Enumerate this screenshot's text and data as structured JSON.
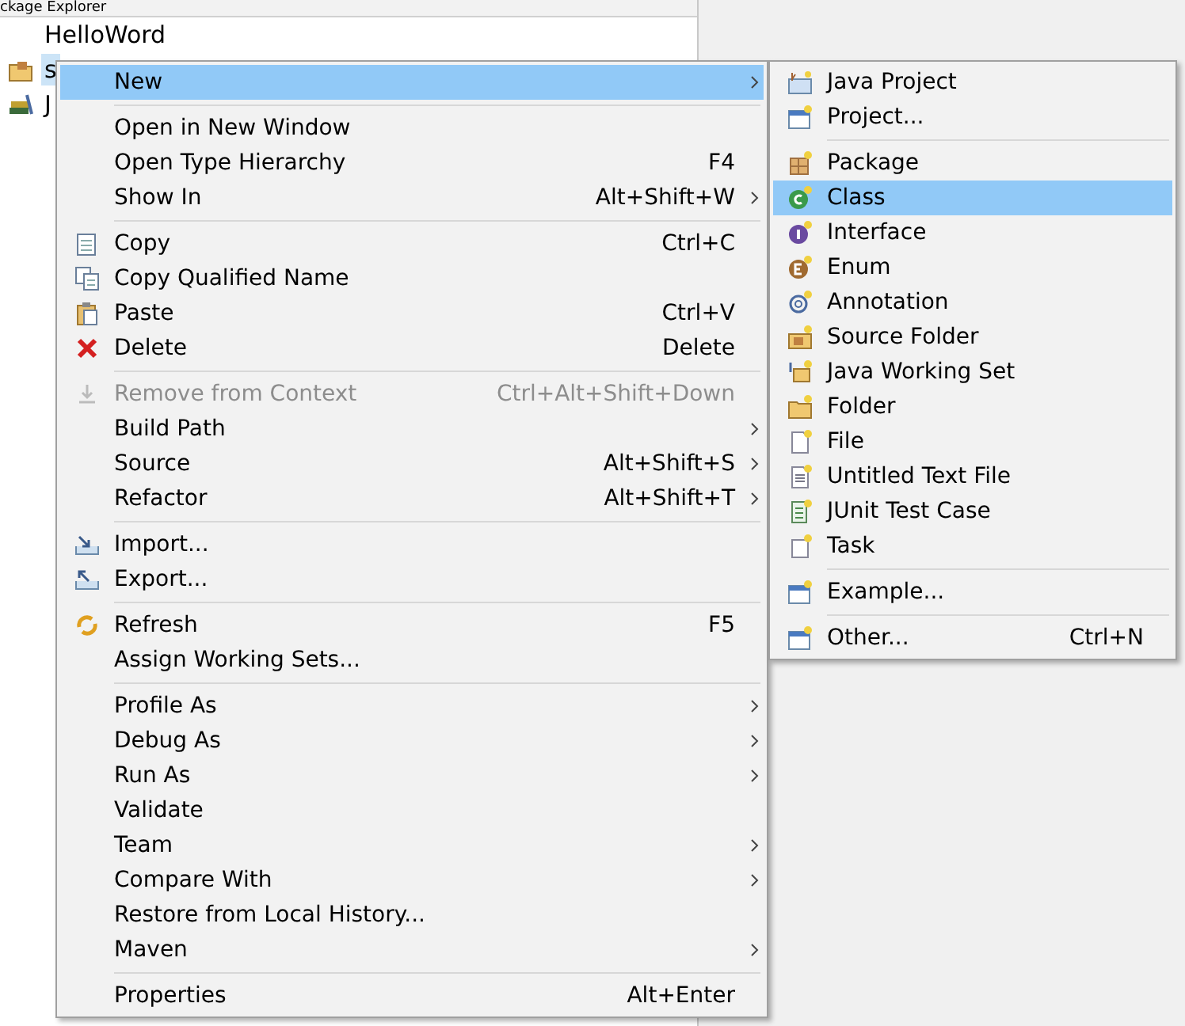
{
  "view": {
    "title": "ckage Explorer"
  },
  "tree": [
    {
      "label": "HelloWord",
      "kind": "project",
      "selected": false
    },
    {
      "label": "s",
      "kind": "folder",
      "selected": true
    },
    {
      "label": "J",
      "kind": "library",
      "selected": false
    }
  ],
  "context_menu": [
    {
      "kind": "plain",
      "label": "New",
      "submenu": true,
      "selected": true,
      "disabled": false
    },
    {
      "kind": "separator"
    },
    {
      "kind": "plain",
      "label": "Open in New Window",
      "submenu": false,
      "selected": false,
      "disabled": false
    },
    {
      "kind": "plain",
      "label": "Open Type Hierarchy",
      "shortcut": "F4",
      "submenu": false,
      "selected": false,
      "disabled": false
    },
    {
      "kind": "plain",
      "label": "Show In",
      "shortcut": "Alt+Shift+W",
      "submenu": true,
      "selected": false,
      "disabled": false
    },
    {
      "kind": "separator"
    },
    {
      "kind": "copy",
      "label": "Copy",
      "shortcut": "Ctrl+C",
      "submenu": false,
      "selected": false,
      "disabled": false
    },
    {
      "kind": "copy2",
      "label": "Copy Qualified Name",
      "submenu": false,
      "selected": false,
      "disabled": false
    },
    {
      "kind": "paste",
      "label": "Paste",
      "shortcut": "Ctrl+V",
      "submenu": false,
      "selected": false,
      "disabled": false
    },
    {
      "kind": "delete",
      "label": "Delete",
      "shortcut": "Delete",
      "submenu": false,
      "selected": false,
      "disabled": false
    },
    {
      "kind": "separator"
    },
    {
      "kind": "remove",
      "label": "Remove from Context",
      "shortcut": "Ctrl+Alt+Shift+Down",
      "submenu": false,
      "selected": false,
      "disabled": true
    },
    {
      "kind": "plain",
      "label": "Build Path",
      "submenu": true,
      "selected": false,
      "disabled": false
    },
    {
      "kind": "plain",
      "label": "Source",
      "shortcut": "Alt+Shift+S",
      "submenu": true,
      "selected": false,
      "disabled": false
    },
    {
      "kind": "plain",
      "label": "Refactor",
      "shortcut": "Alt+Shift+T",
      "submenu": true,
      "selected": false,
      "disabled": false
    },
    {
      "kind": "separator"
    },
    {
      "kind": "import",
      "label": "Import...",
      "submenu": false,
      "selected": false,
      "disabled": false
    },
    {
      "kind": "export",
      "label": "Export...",
      "submenu": false,
      "selected": false,
      "disabled": false
    },
    {
      "kind": "separator"
    },
    {
      "kind": "refresh",
      "label": "Refresh",
      "shortcut": "F5",
      "submenu": false,
      "selected": false,
      "disabled": false
    },
    {
      "kind": "plain",
      "label": "Assign Working Sets...",
      "submenu": false,
      "selected": false,
      "disabled": false
    },
    {
      "kind": "separator"
    },
    {
      "kind": "plain",
      "label": "Profile As",
      "submenu": true,
      "selected": false,
      "disabled": false
    },
    {
      "kind": "plain",
      "label": "Debug As",
      "submenu": true,
      "selected": false,
      "disabled": false
    },
    {
      "kind": "plain",
      "label": "Run As",
      "submenu": true,
      "selected": false,
      "disabled": false
    },
    {
      "kind": "plain",
      "label": "Validate",
      "submenu": false,
      "selected": false,
      "disabled": false
    },
    {
      "kind": "plain",
      "label": "Team",
      "submenu": true,
      "selected": false,
      "disabled": false
    },
    {
      "kind": "plain",
      "label": "Compare With",
      "submenu": true,
      "selected": false,
      "disabled": false
    },
    {
      "kind": "plain",
      "label": "Restore from Local History...",
      "submenu": false,
      "selected": false,
      "disabled": false
    },
    {
      "kind": "plain",
      "label": "Maven",
      "submenu": true,
      "selected": false,
      "disabled": false
    },
    {
      "kind": "separator"
    },
    {
      "kind": "plain",
      "label": "Properties",
      "shortcut": "Alt+Enter",
      "submenu": false,
      "selected": false,
      "disabled": false
    }
  ],
  "new_submenu": [
    {
      "kind": "javaproject",
      "label": "Java Project",
      "selected": false
    },
    {
      "kind": "window",
      "label": "Project...",
      "selected": false
    },
    {
      "kind": "separator"
    },
    {
      "kind": "package",
      "label": "Package",
      "selected": false
    },
    {
      "kind": "class",
      "label": "Class",
      "selected": true
    },
    {
      "kind": "interface",
      "label": "Interface",
      "selected": false
    },
    {
      "kind": "enum",
      "label": "Enum",
      "selected": false
    },
    {
      "kind": "annotation",
      "label": "Annotation",
      "selected": false
    },
    {
      "kind": "sourcefolder",
      "label": "Source Folder",
      "selected": false
    },
    {
      "kind": "workingset",
      "label": "Java Working Set",
      "selected": false
    },
    {
      "kind": "folder",
      "label": "Folder",
      "selected": false
    },
    {
      "kind": "file",
      "label": "File",
      "selected": false
    },
    {
      "kind": "textfile",
      "label": "Untitled Text File",
      "selected": false
    },
    {
      "kind": "junit",
      "label": "JUnit Test Case",
      "selected": false
    },
    {
      "kind": "task",
      "label": "Task",
      "selected": false
    },
    {
      "kind": "separator"
    },
    {
      "kind": "window",
      "label": "Example...",
      "selected": false
    },
    {
      "kind": "separator"
    },
    {
      "kind": "window",
      "label": "Other...",
      "shortcut": "Ctrl+N",
      "selected": false
    }
  ]
}
